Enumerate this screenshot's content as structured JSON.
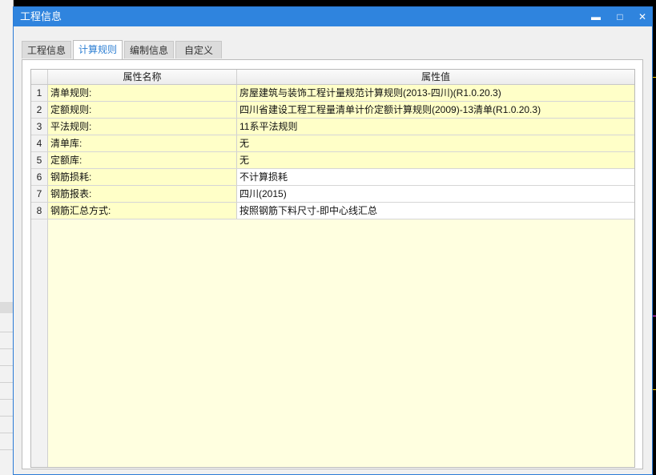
{
  "window": {
    "title": "工程信息",
    "controls": {
      "minimize": "▬",
      "maximize": "□",
      "close": "✕"
    }
  },
  "tabs": [
    {
      "label": "工程信息",
      "active": false
    },
    {
      "label": "计算规则",
      "active": true
    },
    {
      "label": "编制信息",
      "active": false
    },
    {
      "label": "自定义",
      "active": false
    }
  ],
  "table": {
    "headers": [
      "属性名称",
      "属性值"
    ],
    "rows": [
      {
        "num": "1",
        "name": "清单规则:",
        "value": "房屋建筑与装饰工程计量规范计算规则(2013-四川)(R1.0.20.3)"
      },
      {
        "num": "2",
        "name": "定额规则:",
        "value": "四川省建设工程工程量清单计价定额计算规则(2009)-13清单(R1.0.20.3)"
      },
      {
        "num": "3",
        "name": "平法规则:",
        "value": "11系平法规则"
      },
      {
        "num": "4",
        "name": "清单库:",
        "value": "无"
      },
      {
        "num": "5",
        "name": "定额库:",
        "value": "无"
      },
      {
        "num": "6",
        "name": "钢筋损耗:",
        "value": "不计算损耗"
      },
      {
        "num": "7",
        "name": "钢筋报表:",
        "value": "四川(2015)"
      },
      {
        "num": "8",
        "name": "钢筋汇总方式:",
        "value": "按照钢筋下料尺寸-即中心线汇总"
      }
    ]
  },
  "colors": {
    "titlebar": "#2f84de",
    "cell_highlight": "#ffffc8",
    "active_tab_text": "#2d7fd3"
  }
}
